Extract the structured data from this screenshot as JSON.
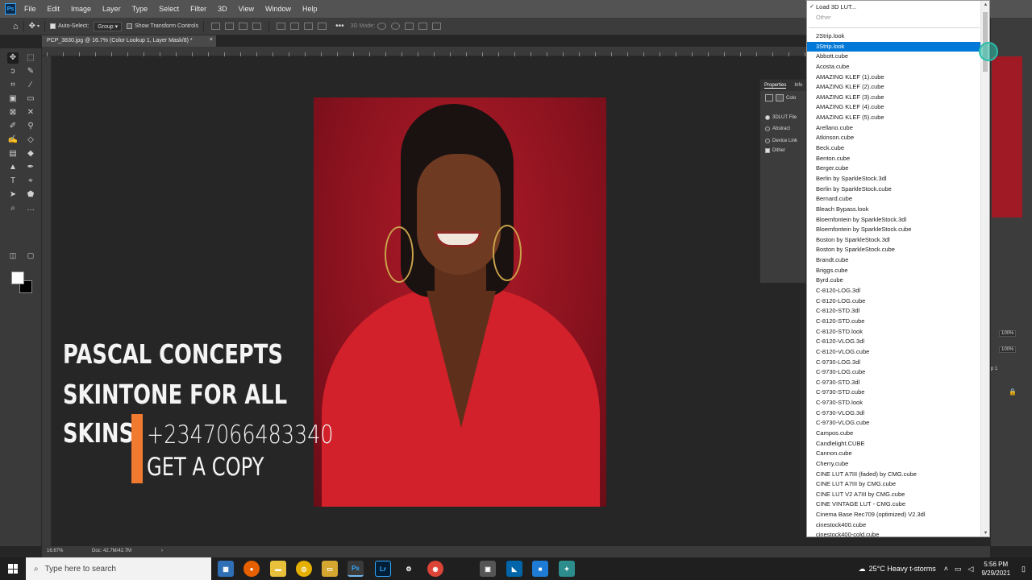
{
  "app": {
    "logo": "Ps"
  },
  "menu": [
    "File",
    "Edit",
    "Image",
    "Layer",
    "Type",
    "Select",
    "Filter",
    "3D",
    "View",
    "Window",
    "Help"
  ],
  "options_bar": {
    "auto_select_label": "Auto-Select:",
    "auto_select_value": "Group",
    "show_transform_label": "Show Transform Controls",
    "mode_3d_label": "3D Mode:"
  },
  "document": {
    "tab_title": "PCP_3830.jpg @ 16.7% (Color Lookup 1, Layer Mask/8) *",
    "close": "×"
  },
  "overlay": {
    "line1": "PASCAL CONCEPTS",
    "line2": "SKINTONE FOR ALL",
    "line3": "SKINS",
    "phone": "+2347066483340",
    "cta": "GET A COPY",
    "accent_color": "#f07a30"
  },
  "properties_panel": {
    "tab_properties": "Properties",
    "tab_info": "Info",
    "type_label": "Colo",
    "options": [
      {
        "label": "3DLUT File",
        "selected": true
      },
      {
        "label": "Abstract",
        "selected": false
      },
      {
        "label": "Device Link",
        "selected": false
      }
    ],
    "dither_label": "Dither"
  },
  "right_panel": {
    "opacity": "100%",
    "fill": "100%",
    "layer_hint": "p 1"
  },
  "dropdown": {
    "load_label": "Load 3D LUT...",
    "other_label": "Other",
    "highlighted": "3Strip.look",
    "items": [
      "2Strip.look",
      "3Strip.look",
      "Abbott.cube",
      "Acosta.cube",
      "AMAZING KLEF (1).cube",
      "AMAZING KLEF (2).cube",
      "AMAZING KLEF (3).cube",
      "AMAZING KLEF (4).cube",
      "AMAZING KLEF (5).cube",
      "Arellano.cube",
      "Atkinson.cube",
      "Beck.cube",
      "Benton.cube",
      "Berger.cube",
      "Berlin by SparkleStock.3dl",
      "Berlin by SparkleStock.cube",
      "Bernard.cube",
      "Bleach Bypass.look",
      "Bloemfontein by SparkleStock.3dl",
      "Bloemfontein by SparkleStock.cube",
      "Boston by SparkleStock.3dl",
      "Boston by SparkleStock.cube",
      "Brandt.cube",
      "Briggs.cube",
      "Byrd.cube",
      "C-8120-LOG.3dl",
      "C-8120-LOG.cube",
      "C-8120-STD.3dl",
      "C-8120-STD.cube",
      "C-8120-STD.look",
      "C-8120-VLOG.3dl",
      "C-8120-VLOG.cube",
      "C-9730-LOG.3dl",
      "C-9730-LOG.cube",
      "C-9730-STD.3dl",
      "C-9730-STD.cube",
      "C-9730-STD.look",
      "C-9730-VLOG.3dl",
      "C-9730-VLOG.cube",
      "Campos.cube",
      "Candlelight.CUBE",
      "Cannon.cube",
      "Cherry.cube",
      "CINE LUT A7III (faded) by CMG.cube",
      "CINE LUT A7III by CMG.cube",
      "CINE LUT V2 A7III by CMG.cube",
      "CINE VINTAGE LUT - CMG.cube",
      "Cinema Base Rec709 (optimized) V2.3dl",
      "cinestock400.cube",
      "cinestock400-cold.cube"
    ]
  },
  "status": {
    "zoom": "16.67%",
    "doc": "Doc: 42.7M/42.7M"
  },
  "taskbar": {
    "search_placeholder": "Type here to search",
    "weather": "25°C  Heavy t-storms",
    "time": "5:56 PM",
    "date": "9/29/2021",
    "apps": [
      "Calculator",
      "Firefox",
      "File Explorer",
      "Chrome Canary",
      "Folder",
      "Photoshop",
      "Lightroom",
      "Settings",
      "Chrome",
      "Photos",
      "VS Code",
      "Store",
      "Tool"
    ]
  }
}
